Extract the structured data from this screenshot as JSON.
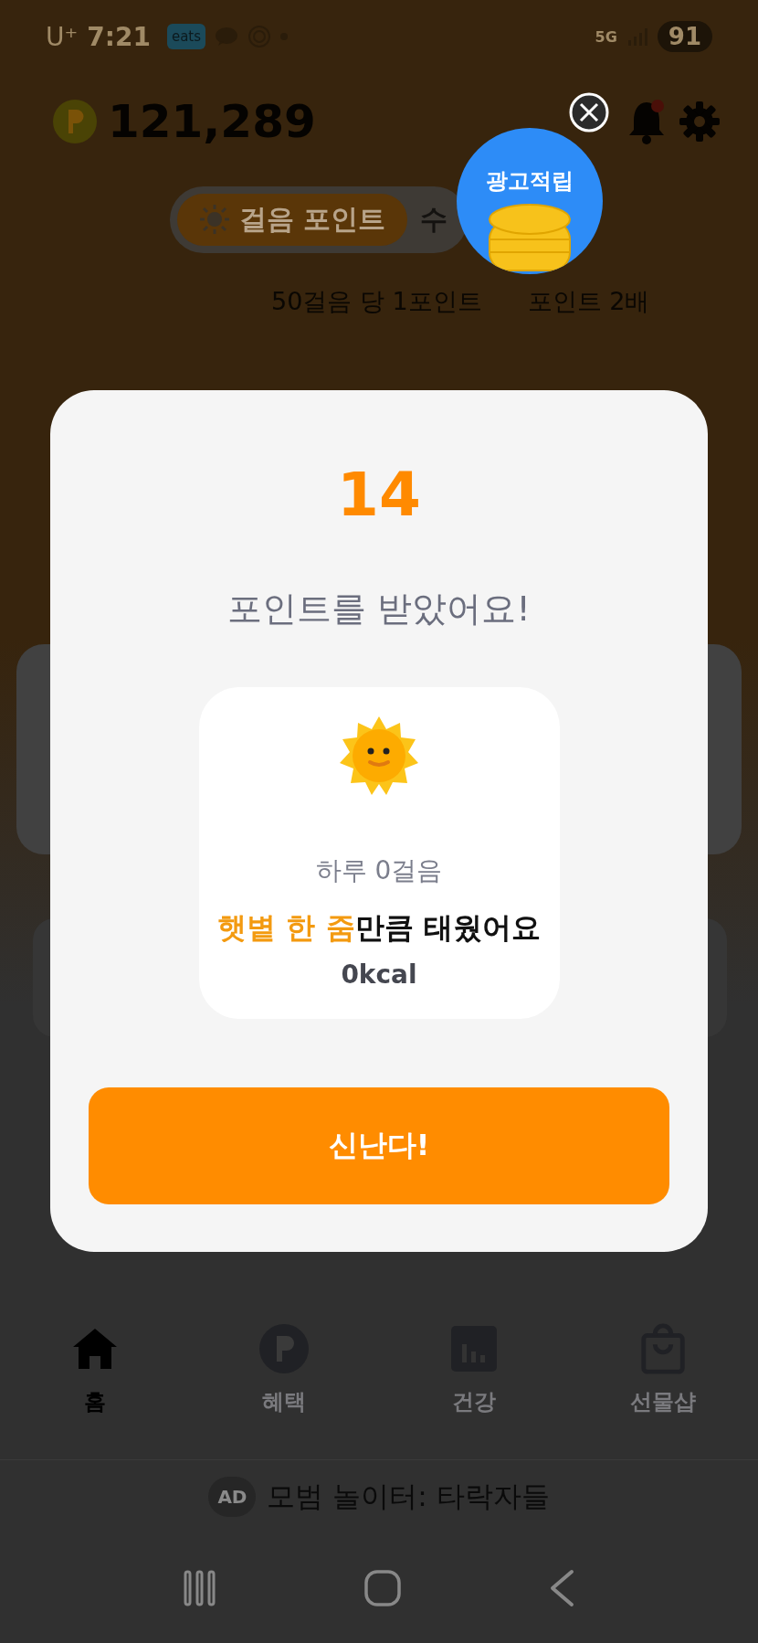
{
  "status_bar": {
    "carrier": "U⁺",
    "time": "7:21",
    "app_badge": "eats",
    "network": "5G",
    "battery": "91"
  },
  "header": {
    "points": "121,289"
  },
  "mode_tabs": [
    {
      "label": "걸음 포인트",
      "selected": true
    },
    {
      "label": "수",
      "selected": false
    }
  ],
  "ad_bubble": {
    "label": "광고적립"
  },
  "info": [
    "50걸음 당 1포인트",
    "포인트 2배"
  ],
  "modal": {
    "points": "14",
    "title": "포인트를 받았어요!",
    "steps": "하루 0걸음",
    "message": "**햇볕 한 줌**만큼 태웠어요",
    "calories": "0kcal",
    "button": "신난다!"
  },
  "bottom_nav": [
    {
      "label": "홈",
      "kind": "home",
      "selected": true
    },
    {
      "label": "혜택",
      "kind": "points",
      "selected": false
    },
    {
      "label": "건강",
      "kind": "chart",
      "selected": false
    },
    {
      "label": "선물샵",
      "kind": "bag",
      "selected": false
    }
  ],
  "ad_banner": {
    "badge": "AD",
    "title": "모범 놀이터: 타락자들"
  }
}
